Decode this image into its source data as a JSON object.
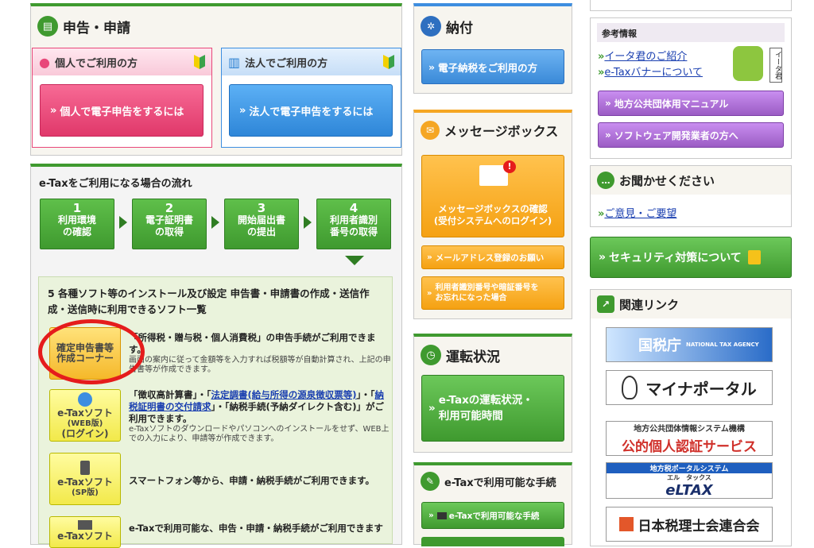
{
  "shinkoku": {
    "title": "申告・申請",
    "individual": {
      "header": "個人でご利用の方",
      "button": "個人で電子申告をするには"
    },
    "corporate": {
      "header": "法人でご利用の方",
      "button": "法人で電子申告をするには"
    }
  },
  "flow": {
    "title": "e-Taxをご利用になる場合の流れ",
    "steps": [
      {
        "num": "1",
        "line1": "利用環境",
        "line2": "の確認"
      },
      {
        "num": "2",
        "line1": "電子証明書",
        "line2": "の取得"
      },
      {
        "num": "3",
        "line1": "開始届出書",
        "line2": "の提出"
      },
      {
        "num": "4",
        "line1": "利用者識別",
        "line2": "番号の取得"
      }
    ],
    "step5_title": "5 各種ソフト等のインストール及び設定 申告書・申請書の作成・送信作成・送信時に利用できるソフト一覧"
  },
  "software": [
    {
      "label1": "確定申告書等",
      "label2": "作成コーナー",
      "desc": "「所得税・贈与税・個人消費税」の申告手続がご利用できます。",
      "note": "画面の案内に従って金額等を入力すれば税額等が自動計算され、上記の申告書等が作成できます。"
    },
    {
      "label1": "e-Taxソフト",
      "label2": "(WEB版)",
      "label3": "(ログイン)",
      "desc_a": "「徴収高計算書」・「",
      "link1": "法定調書(給与所得の源泉徴収票等)",
      "desc_b": "」・「",
      "link2": "納税証明書の交付請求",
      "desc_c": "」・「納税手続(予納ダイレクト含む)」がご利用できます。",
      "note": "e-Taxソフトのダウンロードやパソコンへのインストールをせず、WEB上での入力により、申請等が作成できます。"
    },
    {
      "label1": "e-Taxソフト",
      "label2": "(SP版)",
      "desc": "スマートフォン等から、申請・納税手続がご利用できます。"
    },
    {
      "label1": "e-Taxソフト",
      "desc": "e-Taxで利用可能な、申告・申請・納税手続がご利用できます"
    }
  ],
  "nofu": {
    "title": "納付",
    "button": "電子納税をご利用の方"
  },
  "message": {
    "title": "メッセージボックス",
    "main_button_line1": "メッセージボックスの確認",
    "main_button_line2": "(受付システムへのログイン)",
    "mail_button": "メールアドレス登録のお願い",
    "forgot_line1": "利用者識別番号や暗証番号を",
    "forgot_line2": "お忘れになった場合"
  },
  "status": {
    "title": "運転状況",
    "button_line1": "e-Taxの運転状況・",
    "button_line2": "利用可能時間"
  },
  "procedures": {
    "title": "e-Taxで利用可能な手続",
    "button": "e-Taxで利用可能な手続"
  },
  "sankou": {
    "title": "参考情報",
    "link1": "イータ君のご紹介",
    "link2": "e-Taxバナーについて",
    "tag": "イータ君",
    "btn1": "地方公共団体用マニュアル",
    "btn2": "ソフトウェア開発業者の方へ"
  },
  "feedback": {
    "title": "お聞かせください",
    "link": "ご意見・ご要望"
  },
  "security": {
    "button": "セキュリティ対策について"
  },
  "related": {
    "title": "関連リンク",
    "kokuzei": "国税庁",
    "kokuzei_en": "NATIONAL TAX AGENCY",
    "mynaportal": "マイナポータル",
    "jpki_line1": "地方公共団体情報システム機構",
    "jpki_line2": "公的個人認証サービス",
    "eltax_top": "地方税ポータルシステム",
    "eltax_ruby": "エル　タックス",
    "eltax": "eLTAX",
    "zeirishi": "日本税理士会連合会"
  },
  "colors": {
    "green": "#3f9a2f",
    "pink": "#e8487a",
    "blue": "#3d8ee0",
    "orange": "#f5a623",
    "purple": "#9b5cc4",
    "highlight": "#e51c1c"
  }
}
